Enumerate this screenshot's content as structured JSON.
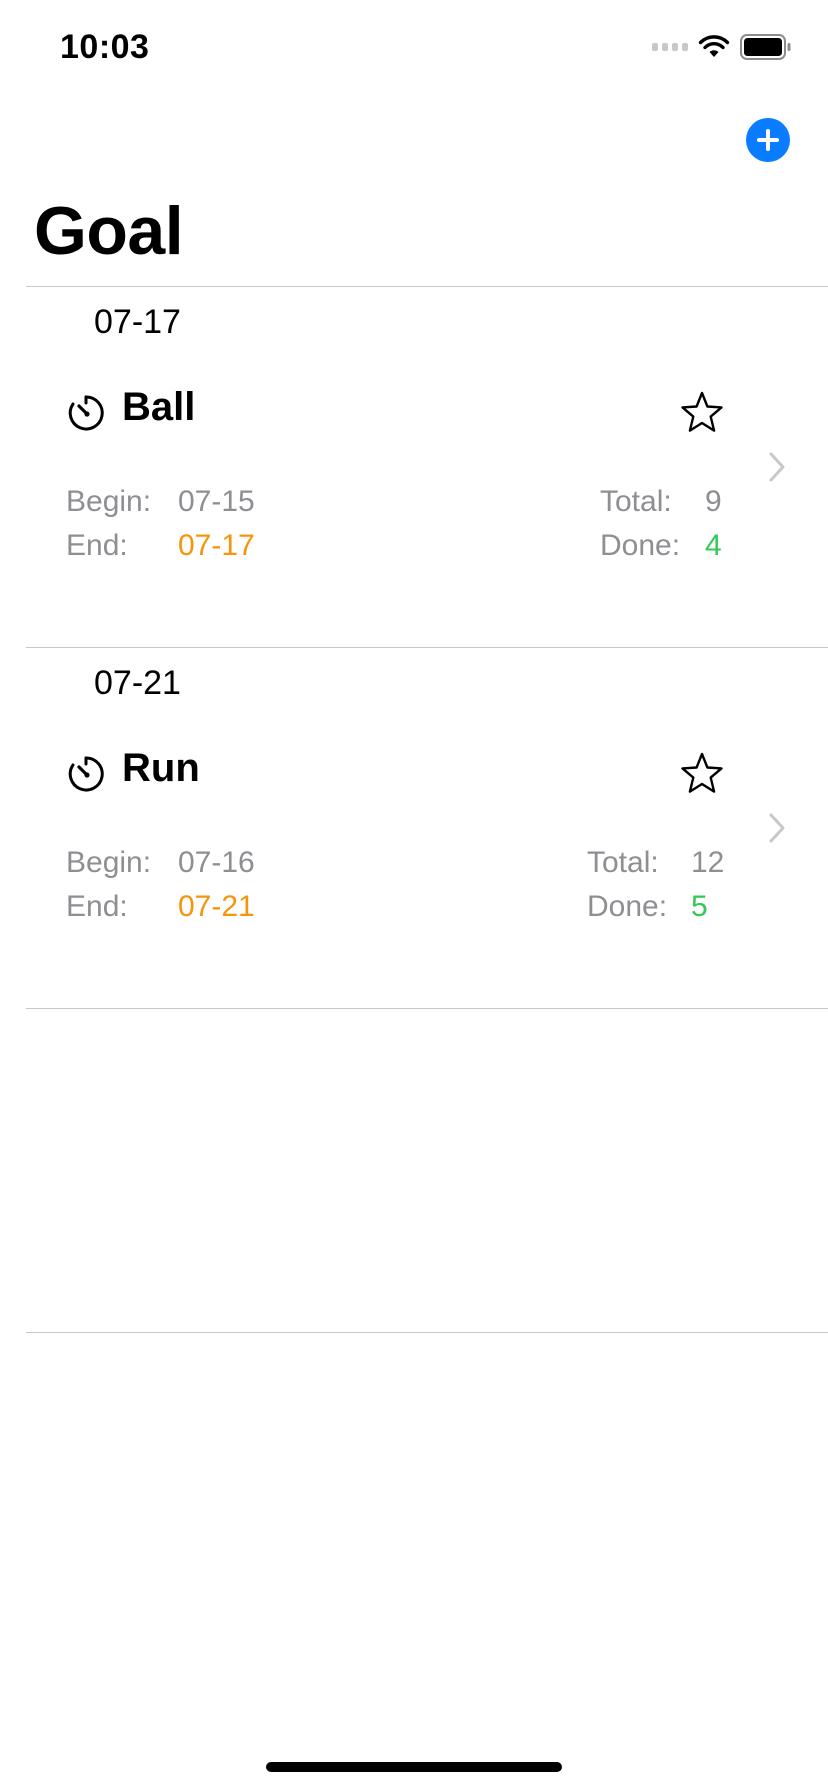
{
  "status_bar": {
    "time": "10:03"
  },
  "header": {
    "title": "Goal",
    "add_icon": "plus-circle-icon"
  },
  "goals": [
    {
      "section_date": "07-17",
      "name": "Ball",
      "begin_label": "Begin:",
      "begin_value": "07-15",
      "end_label": "End:",
      "end_value": "07-17",
      "total_label": "Total:",
      "total_value": "9",
      "done_label": "Done:",
      "done_value": "4"
    },
    {
      "section_date": "07-21",
      "name": "Run",
      "begin_label": "Begin:",
      "begin_value": "07-16",
      "end_label": "End:",
      "end_value": "07-21",
      "total_label": "Total:",
      "total_value": "12",
      "done_label": "Done:",
      "done_value": "5"
    }
  ],
  "colors": {
    "accent": "#0a7cff",
    "end_date": "#f5950a",
    "done": "#34c759",
    "secondary_text": "#8e8e93"
  }
}
